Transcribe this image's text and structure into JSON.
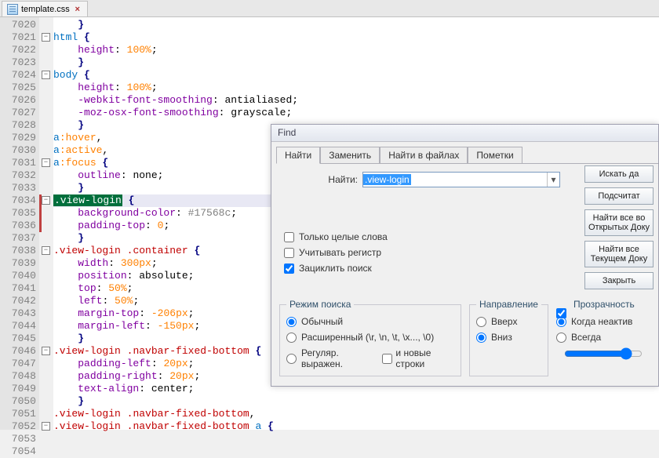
{
  "tab": {
    "filename": "template.css"
  },
  "gutter_start": 7020,
  "gutter_count": 35,
  "code_lines": [
    {
      "tokens": [
        [
          "    }",
          "t-punc"
        ]
      ]
    },
    {
      "fold": "-",
      "tokens": [
        [
          "html",
          "t-sel"
        ],
        [
          " {",
          "t-punc"
        ]
      ]
    },
    {
      "tokens": [
        [
          "    ",
          ""
        ],
        [
          "height",
          "t-prop"
        ],
        [
          ": ",
          ""
        ],
        [
          "100",
          "t-num"
        ],
        [
          "%",
          "t-unit"
        ],
        [
          ";",
          ""
        ]
      ]
    },
    {
      "tokens": [
        [
          "    }",
          "t-punc"
        ]
      ]
    },
    {
      "fold": "-",
      "tokens": [
        [
          "body",
          "t-sel"
        ],
        [
          " {",
          "t-punc"
        ]
      ]
    },
    {
      "tokens": [
        [
          "    ",
          ""
        ],
        [
          "height",
          "t-prop"
        ],
        [
          ": ",
          ""
        ],
        [
          "100",
          "t-num"
        ],
        [
          "%",
          "t-unit"
        ],
        [
          ";",
          ""
        ]
      ]
    },
    {
      "tokens": [
        [
          "    ",
          ""
        ],
        [
          "-webkit-font-smoothing",
          "t-prop"
        ],
        [
          ": ",
          ""
        ],
        [
          "antialiased",
          "t-val"
        ],
        [
          ";",
          ""
        ]
      ]
    },
    {
      "tokens": [
        [
          "    ",
          ""
        ],
        [
          "-moz-osx-font-smoothing",
          "t-prop"
        ],
        [
          ": ",
          ""
        ],
        [
          "grayscale",
          "t-val"
        ],
        [
          ";",
          ""
        ]
      ]
    },
    {
      "tokens": [
        [
          "    }",
          "t-punc"
        ]
      ]
    },
    {
      "tokens": [
        [
          "a",
          "t-sel"
        ],
        [
          ":hover",
          "t-pseudo"
        ],
        [
          ",",
          ""
        ]
      ]
    },
    {
      "tokens": [
        [
          "a",
          "t-sel"
        ],
        [
          ":active",
          "t-pseudo"
        ],
        [
          ",",
          ""
        ]
      ]
    },
    {
      "fold": "-",
      "tokens": [
        [
          "a",
          "t-sel"
        ],
        [
          ":focus",
          "t-pseudo"
        ],
        [
          " {",
          "t-punc"
        ]
      ]
    },
    {
      "tokens": [
        [
          "    ",
          ""
        ],
        [
          "outline",
          "t-prop"
        ],
        [
          ": ",
          ""
        ],
        [
          "none",
          "t-val"
        ],
        [
          ";",
          ""
        ]
      ]
    },
    {
      "tokens": [
        [
          "    }",
          "t-punc"
        ]
      ]
    },
    {
      "fold": "-",
      "highlight": true,
      "red": true,
      "tokens": [
        [
          ".view-login",
          "hl-match"
        ],
        [
          " {",
          "t-punc"
        ]
      ]
    },
    {
      "red": true,
      "tokens": [
        [
          "    ",
          ""
        ],
        [
          "background-color",
          "t-prop"
        ],
        [
          ": ",
          ""
        ],
        [
          "#17568c",
          "t-hash"
        ],
        [
          ";",
          ""
        ]
      ]
    },
    {
      "red": true,
      "tokens": [
        [
          "    ",
          ""
        ],
        [
          "padding-top",
          "t-prop"
        ],
        [
          ": ",
          ""
        ],
        [
          "0",
          "t-num"
        ],
        [
          ";",
          ""
        ]
      ]
    },
    {
      "tokens": [
        [
          "    }",
          "t-punc"
        ]
      ]
    },
    {
      "fold": "-",
      "tokens": [
        [
          ".view-login",
          "t-class"
        ],
        [
          " ",
          ""
        ],
        [
          ".container",
          "t-class"
        ],
        [
          " {",
          "t-punc"
        ]
      ]
    },
    {
      "tokens": [
        [
          "    ",
          ""
        ],
        [
          "width",
          "t-prop"
        ],
        [
          ": ",
          ""
        ],
        [
          "300",
          "t-num"
        ],
        [
          "px",
          "t-unit"
        ],
        [
          ";",
          ""
        ]
      ]
    },
    {
      "tokens": [
        [
          "    ",
          ""
        ],
        [
          "position",
          "t-prop"
        ],
        [
          ": ",
          ""
        ],
        [
          "absolute",
          "t-val"
        ],
        [
          ";",
          ""
        ]
      ]
    },
    {
      "tokens": [
        [
          "    ",
          ""
        ],
        [
          "top",
          "t-prop"
        ],
        [
          ": ",
          ""
        ],
        [
          "50",
          "t-num"
        ],
        [
          "%",
          "t-unit"
        ],
        [
          ";",
          ""
        ]
      ]
    },
    {
      "tokens": [
        [
          "    ",
          ""
        ],
        [
          "left",
          "t-prop"
        ],
        [
          ": ",
          ""
        ],
        [
          "50",
          "t-num"
        ],
        [
          "%",
          "t-unit"
        ],
        [
          ";",
          ""
        ]
      ]
    },
    {
      "tokens": [
        [
          "    ",
          ""
        ],
        [
          "margin-top",
          "t-prop"
        ],
        [
          ": ",
          ""
        ],
        [
          "-206",
          "t-num"
        ],
        [
          "px",
          "t-unit"
        ],
        [
          ";",
          ""
        ]
      ]
    },
    {
      "tokens": [
        [
          "    ",
          ""
        ],
        [
          "margin-left",
          "t-prop"
        ],
        [
          ": ",
          ""
        ],
        [
          "-150",
          "t-num"
        ],
        [
          "px",
          "t-unit"
        ],
        [
          ";",
          ""
        ]
      ]
    },
    {
      "tokens": [
        [
          "    }",
          "t-punc"
        ]
      ]
    },
    {
      "fold": "-",
      "tokens": [
        [
          ".view-login",
          "t-class"
        ],
        [
          " ",
          ""
        ],
        [
          ".navbar-fixed-bottom",
          "t-class"
        ],
        [
          " {",
          "t-punc"
        ]
      ]
    },
    {
      "tokens": [
        [
          "    ",
          ""
        ],
        [
          "padding-left",
          "t-prop"
        ],
        [
          ": ",
          ""
        ],
        [
          "20",
          "t-num"
        ],
        [
          "px",
          "t-unit"
        ],
        [
          ";",
          ""
        ]
      ]
    },
    {
      "tokens": [
        [
          "    ",
          ""
        ],
        [
          "padding-right",
          "t-prop"
        ],
        [
          ": ",
          ""
        ],
        [
          "20",
          "t-num"
        ],
        [
          "px",
          "t-unit"
        ],
        [
          ";",
          ""
        ]
      ]
    },
    {
      "tokens": [
        [
          "    ",
          ""
        ],
        [
          "text-align",
          "t-prop"
        ],
        [
          ": ",
          ""
        ],
        [
          "center",
          "t-val"
        ],
        [
          ";",
          ""
        ]
      ]
    },
    {
      "tokens": [
        [
          "    }",
          "t-punc"
        ]
      ]
    },
    {
      "tokens": [
        [
          ".view-login",
          "t-class"
        ],
        [
          " ",
          ""
        ],
        [
          ".navbar-fixed-bottom",
          "t-class"
        ],
        [
          ",",
          ""
        ]
      ]
    },
    {
      "fold": "-",
      "tokens": [
        [
          ".view-login",
          "t-class"
        ],
        [
          " ",
          ""
        ],
        [
          ".navbar-fixed-bottom",
          "t-class"
        ],
        [
          " ",
          ""
        ],
        [
          "a",
          "t-sel"
        ],
        [
          " {",
          "t-punc"
        ]
      ]
    }
  ],
  "find": {
    "title": "Find",
    "tabs": [
      "Найти",
      "Заменить",
      "Найти в файлах",
      "Пометки"
    ],
    "active_tab": 0,
    "field_label": "Найти:",
    "field_value": ".view-login",
    "buttons": {
      "search_next": "Искать да",
      "count": "Подсчитат",
      "find_all_open": "Найти все во Открытых Доку",
      "find_all_current": "Найти все Текущем Доку",
      "close": "Закрыть"
    },
    "checks": {
      "whole_word": "Только целые слова",
      "match_case": "Учитывать регистр",
      "wrap": "Зациклить поиск"
    },
    "mode": {
      "legend": "Режим поиска",
      "normal": "Обычный",
      "extended": "Расширенный (\\r, \\n, \\t, \\x..., \\0)",
      "regex": "Регуляр. выражен.",
      "newlines": "и новые строки"
    },
    "dir": {
      "legend": "Направление",
      "up": "Вверх",
      "down": "Вниз"
    },
    "trans": {
      "legend": "Прозрачность",
      "inactive": "Когда неактив",
      "always": "Всегда"
    }
  }
}
